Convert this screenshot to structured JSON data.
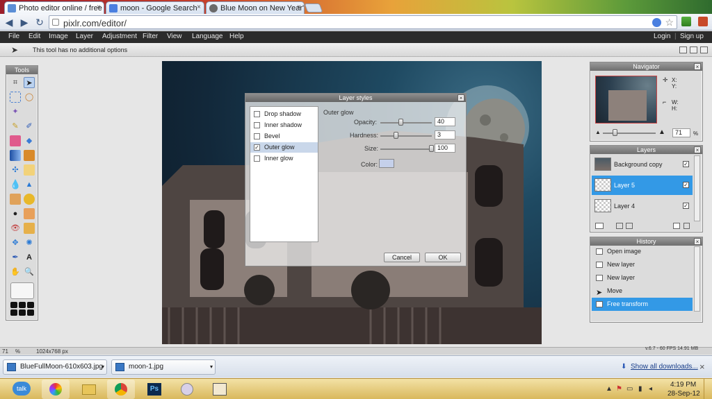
{
  "browser": {
    "tabs": [
      {
        "label": "Photo editor online / free",
        "close": "×"
      },
      {
        "label": "moon - Google Search",
        "close": "×"
      },
      {
        "label": "Blue Moon on New Year's",
        "close": "×"
      }
    ],
    "url": "pixlr.com/editor/",
    "nav": {
      "back": "◀",
      "forward": "▶",
      "reload": "↻"
    }
  },
  "menubar": {
    "items": [
      "File",
      "Edit",
      "Image",
      "Layer",
      "Adjustment",
      "Filter",
      "View",
      "Language",
      "Help"
    ],
    "login": "Login",
    "signup": "Sign up"
  },
  "options_bar": {
    "text": "This tool has no additional options"
  },
  "tools_panel": {
    "title": "Tools"
  },
  "dialog": {
    "title": "Layer styles",
    "close": "×",
    "effects": [
      {
        "label": "Drop shadow",
        "checked": false
      },
      {
        "label": "Inner shadow",
        "checked": false
      },
      {
        "label": "Bevel",
        "checked": false
      },
      {
        "label": "Outer glow",
        "checked": true
      },
      {
        "label": "Inner glow",
        "checked": false
      }
    ],
    "check_mark": "✓",
    "section_title": "Outer glow",
    "opacity_label": "Opacity:",
    "opacity_value": "40",
    "hardness_label": "Hardness:",
    "hardness_value": "3",
    "size_label": "Size:",
    "size_value": "100",
    "color_label": "Color:",
    "color_swatch": "#c5d0ea",
    "cancel": "Cancel",
    "ok": "OK"
  },
  "navigator": {
    "title": "Navigator",
    "x_label": "X:",
    "y_label": "Y:",
    "w_label": "W:",
    "h_label": "H:",
    "zoom_value": "71",
    "zoom_unit": "%"
  },
  "layers": {
    "title": "Layers",
    "items": [
      {
        "label": "Background copy",
        "selected": false
      },
      {
        "label": "Layer 5",
        "selected": true
      },
      {
        "label": "Layer 4",
        "selected": false
      }
    ],
    "check": "✓"
  },
  "history": {
    "title": "History",
    "items": [
      {
        "label": "Open image",
        "selected": false
      },
      {
        "label": "New layer",
        "selected": false
      },
      {
        "label": "New layer",
        "selected": false
      },
      {
        "label": "Move",
        "selected": false
      },
      {
        "label": "Free transform",
        "selected": true
      }
    ]
  },
  "status": {
    "zoom": "71",
    "zoom_unit": "%",
    "dimensions": "1024x768 px",
    "version": "v.6.7 - 60 FPS 14.91 MB"
  },
  "downloads": {
    "items": [
      "BlueFullMoon-610x603.jpg",
      "moon-1.jpg"
    ],
    "show_all": "Show all downloads...",
    "close": "×"
  },
  "taskbar": {
    "time": "4:19 PM",
    "date": "28-Sep-12",
    "talk": "talk",
    "ps": "Ps"
  },
  "colors": {
    "accent_blue": "#3399e6",
    "menubar": "#2b2b2b"
  }
}
